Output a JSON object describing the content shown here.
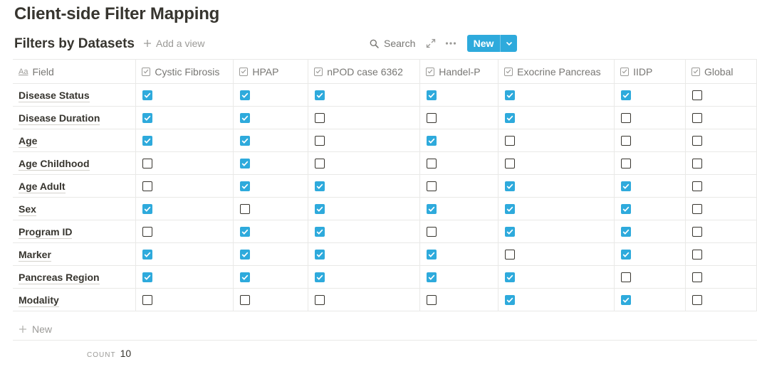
{
  "page": {
    "title": "Client-side Filter Mapping"
  },
  "toolbar": {
    "db_title": "Filters by Datasets",
    "add_view": "Add a view",
    "search": "Search",
    "new_label": "New"
  },
  "table": {
    "field_header": "Field",
    "field_header_icon": "Aa",
    "columns": [
      "Cystic Fibrosis",
      "HPAP",
      "nPOD case 6362",
      "Handel-P",
      "Exocrine Pancreas",
      "IIDP",
      "Global"
    ],
    "rows": [
      {
        "field": "Disease Status",
        "checks": [
          true,
          true,
          true,
          true,
          true,
          true,
          false
        ]
      },
      {
        "field": "Disease Duration",
        "checks": [
          true,
          true,
          false,
          false,
          true,
          false,
          false
        ]
      },
      {
        "field": "Age",
        "checks": [
          true,
          true,
          false,
          true,
          false,
          false,
          false
        ]
      },
      {
        "field": "Age Childhood",
        "checks": [
          false,
          true,
          false,
          false,
          false,
          false,
          false
        ]
      },
      {
        "field": "Age Adult",
        "checks": [
          false,
          true,
          true,
          false,
          true,
          true,
          false
        ]
      },
      {
        "field": "Sex",
        "checks": [
          true,
          false,
          true,
          true,
          true,
          true,
          false
        ]
      },
      {
        "field": "Program ID",
        "checks": [
          false,
          true,
          true,
          false,
          true,
          true,
          false
        ]
      },
      {
        "field": "Marker",
        "checks": [
          true,
          true,
          true,
          true,
          false,
          true,
          false
        ]
      },
      {
        "field": "Pancreas Region",
        "checks": [
          true,
          true,
          true,
          true,
          true,
          false,
          false
        ]
      },
      {
        "field": "Modality",
        "checks": [
          false,
          false,
          false,
          false,
          true,
          true,
          false
        ]
      }
    ]
  },
  "footer": {
    "new_row_label": "New",
    "count_label": "COUNT",
    "count_value": "10"
  },
  "colors": {
    "accent": "#2eaadc",
    "text": "#37352f",
    "muted": "#9b9a97",
    "border": "#e9e9e7"
  },
  "icons": {
    "add_view": "plus-icon",
    "search": "search-icon",
    "expand": "expand-icon",
    "more": "more-horizontal-icon",
    "new_caret": "chevron-down-icon",
    "column_type": "checkbox-property-icon",
    "field_type": "text-property-icon"
  }
}
